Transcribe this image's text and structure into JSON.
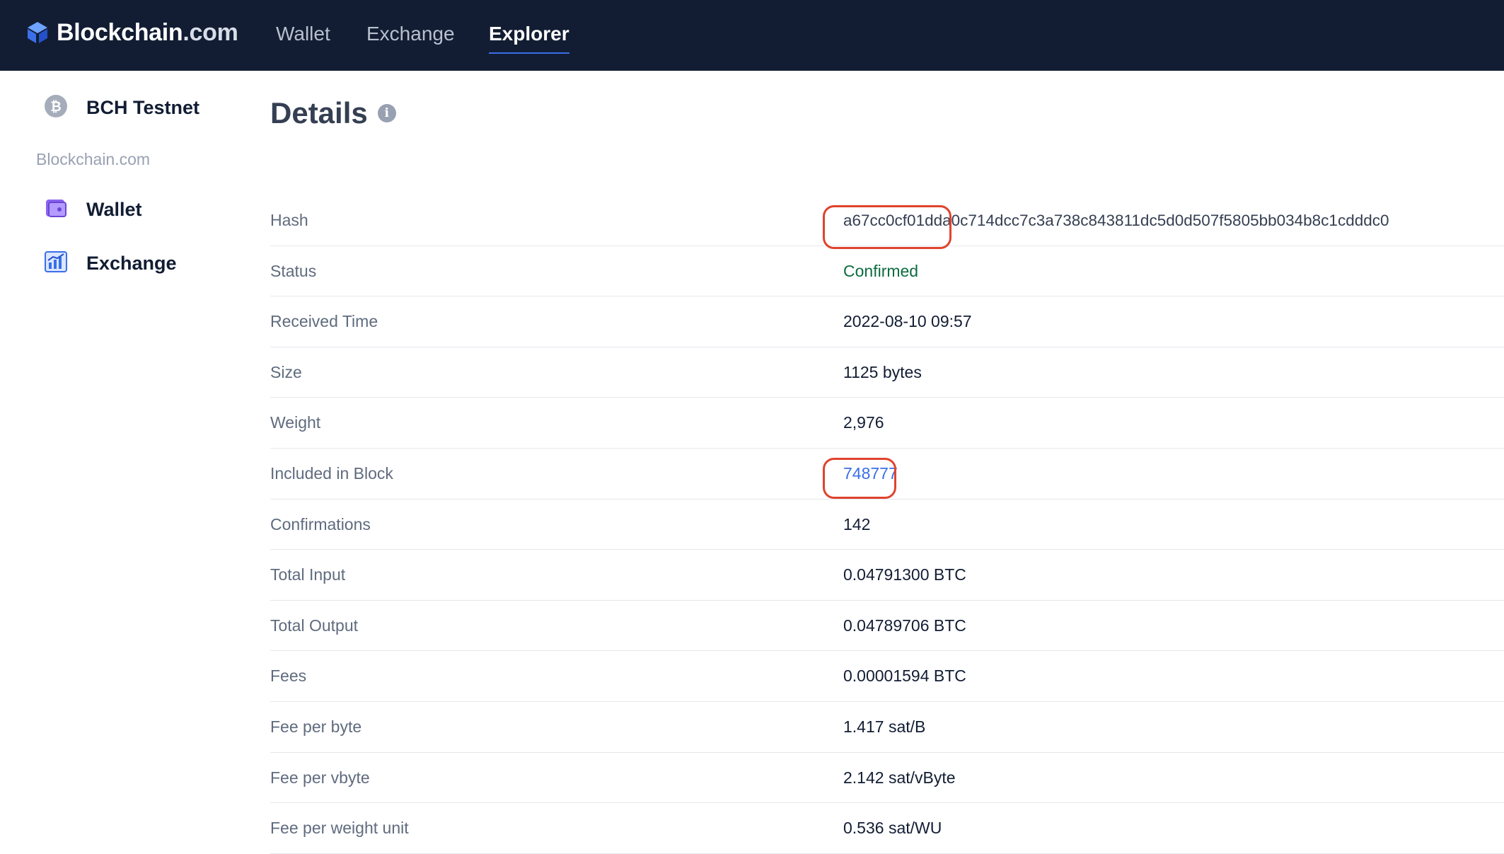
{
  "header": {
    "brand_main": "Blockchain",
    "brand_suffix": ".com",
    "nav": [
      {
        "label": "Wallet",
        "active": false
      },
      {
        "label": "Exchange",
        "active": false
      },
      {
        "label": "Explorer",
        "active": true
      }
    ]
  },
  "sidebar": {
    "network": {
      "label": "BCH Testnet",
      "icon": "bitcoin-cash-icon"
    },
    "section_label": "Blockchain.com",
    "items": [
      {
        "label": "Wallet",
        "icon": "wallet-icon"
      },
      {
        "label": "Exchange",
        "icon": "exchange-chart-icon"
      }
    ]
  },
  "details": {
    "title": "Details",
    "rows": [
      {
        "key": "Hash",
        "value": "a67cc0cf01dda0c714dcc7c3a738c843811dc5d0d507f5805bb034b8c1cdddc0"
      },
      {
        "key": "Status",
        "value": "Confirmed"
      },
      {
        "key": "Received Time",
        "value": "2022-08-10 09:57"
      },
      {
        "key": "Size",
        "value": "1125 bytes"
      },
      {
        "key": "Weight",
        "value": "2,976"
      },
      {
        "key": "Included in Block",
        "value": "748777"
      },
      {
        "key": "Confirmations",
        "value": "142"
      },
      {
        "key": "Total Input",
        "value": "0.04791300 BTC"
      },
      {
        "key": "Total Output",
        "value": "0.04789706 BTC"
      },
      {
        "key": "Fees",
        "value": "0.00001594 BTC"
      },
      {
        "key": "Fee per byte",
        "value": "1.417 sat/B"
      },
      {
        "key": "Fee per vbyte",
        "value": "2.142 sat/vByte"
      },
      {
        "key": "Fee per weight unit",
        "value": "0.536 sat/WU"
      }
    ]
  },
  "colors": {
    "navbar_bg": "#121d33",
    "status_green": "#0c6c3f",
    "link_blue": "#3a6fe8",
    "annotation_red": "#e0432d"
  }
}
